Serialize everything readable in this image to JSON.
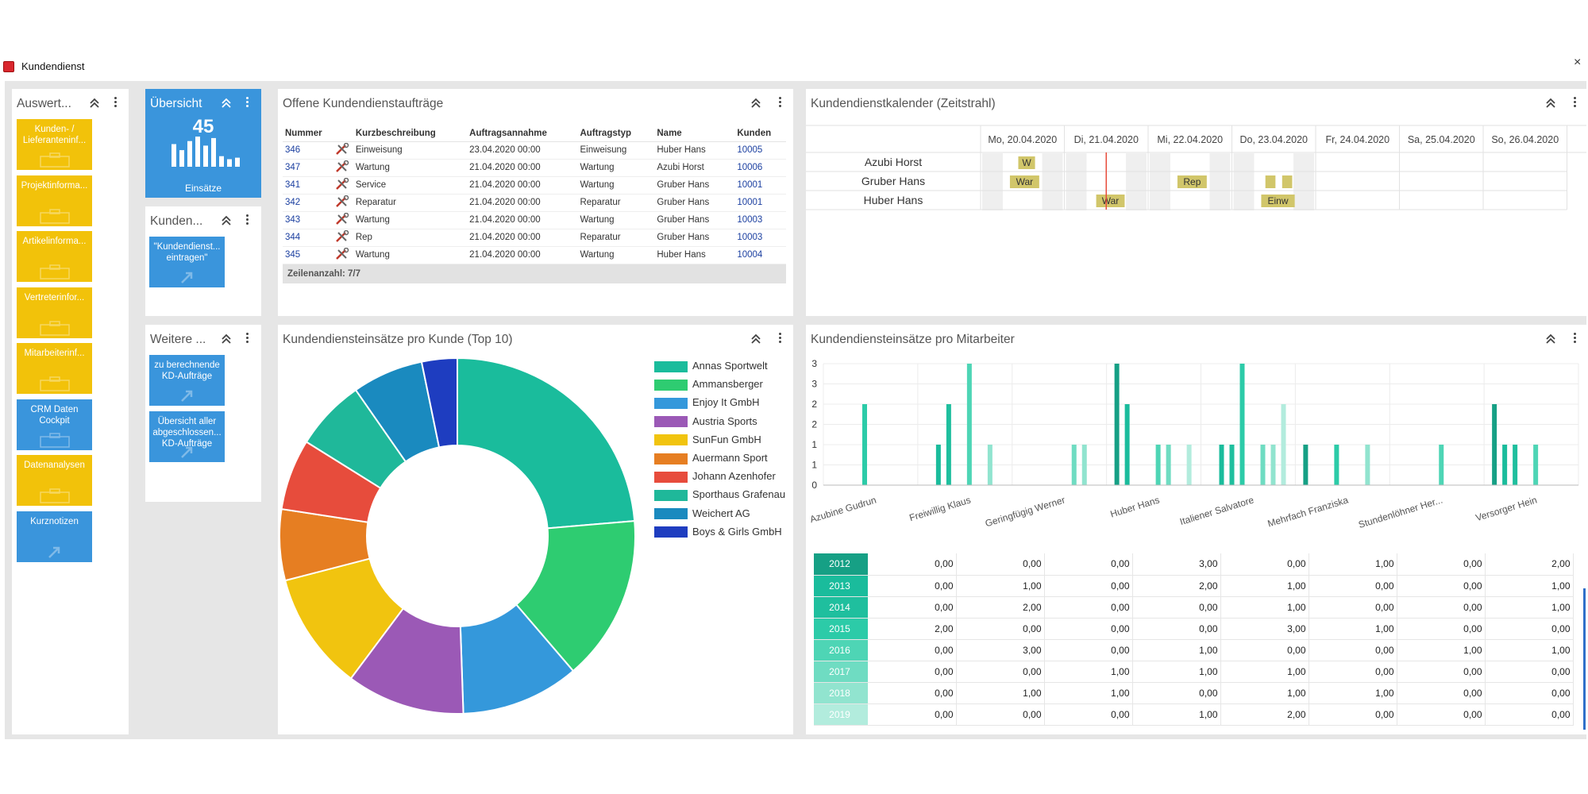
{
  "window": {
    "title": "Kundendienst",
    "close": "×"
  },
  "nav_panel": {
    "title": "Auswert...",
    "tiles": [
      {
        "label": "Kunden- / Lieferanteninf...",
        "color": "yellow"
      },
      {
        "label": "Projektinforma...",
        "color": "yellow"
      },
      {
        "label": "Artikelinforma...",
        "color": "yellow"
      },
      {
        "label": "Vertreterinfor...",
        "color": "yellow"
      },
      {
        "label": "Mitarbeiterinf...",
        "color": "yellow"
      },
      {
        "label": "CRM Daten Cockpit",
        "color": "blue"
      },
      {
        "label": "Datenanalysen",
        "color": "yellow"
      },
      {
        "label": "Kurznotizen",
        "color": "blue"
      }
    ]
  },
  "overview": {
    "title": "Übersicht",
    "value": "45",
    "caption": "Einsätze",
    "sparkline": [
      0.75,
      0.55,
      0.85,
      1.0,
      0.7,
      0.95,
      0.35,
      0.25,
      0.3
    ]
  },
  "kunden_panel": {
    "title": "Kunden...",
    "tiles": [
      {
        "label": "\"Kundendienst... eintragen\""
      }
    ]
  },
  "weitere_panel": {
    "title": "Weitere ...",
    "tiles": [
      {
        "label": "zu berechnende KD-Aufträge"
      },
      {
        "label": "Übersicht aller abgeschlossen... KD-Aufträge"
      }
    ]
  },
  "orders": {
    "title": "Offene Kundendienstaufträge",
    "columns": [
      "Nummer",
      "",
      "Kurzbeschreibung",
      "Auftragsannahme",
      "Auftragstyp",
      "Name",
      "Kunden"
    ],
    "rows": [
      [
        "346",
        "Einweisung",
        "23.04.2020 00:00",
        "Einweisung",
        "Huber Hans",
        "10005"
      ],
      [
        "347",
        "Wartung",
        "21.04.2020 00:00",
        "Wartung",
        "Azubi Horst",
        "10006"
      ],
      [
        "341",
        "Service",
        "21.04.2020 00:00",
        "Wartung",
        "Gruber Hans",
        "10001"
      ],
      [
        "342",
        "Reparatur",
        "21.04.2020 00:00",
        "Reparatur",
        "Gruber Hans",
        "10001"
      ],
      [
        "343",
        "Wartung",
        "21.04.2020 00:00",
        "Wartung",
        "Gruber Hans",
        "10003"
      ],
      [
        "344",
        "Rep",
        "21.04.2020 00:00",
        "Reparatur",
        "Gruber Hans",
        "10003"
      ],
      [
        "345",
        "Wartung",
        "21.04.2020 00:00",
        "Wartung",
        "Huber Hans",
        "10004"
      ]
    ],
    "footer": "Zeilenanzahl: 7/7"
  },
  "calendar": {
    "title": "Kundendienstkalender (Zeitstrahl)",
    "days": [
      "Mo, 20.04.2020",
      "Di, 21.04.2020",
      "Mi, 22.04.2020",
      "Do, 23.04.2020",
      "Fr, 24.04.2020",
      "Sa, 25.04.2020",
      "So, 26.04.2020"
    ],
    "resources": [
      {
        "name": "Azubi Horst",
        "events": [
          {
            "label": "W",
            "day": 0,
            "start": 0.45,
            "end": 0.65
          }
        ]
      },
      {
        "name": "Gruber Hans",
        "events": [
          {
            "label": "War",
            "day": 0,
            "start": 0.35,
            "end": 0.7
          },
          {
            "label": "Rep",
            "day": 2,
            "start": 0.35,
            "end": 0.7
          },
          {
            "label": "",
            "day": 3,
            "start": 0.4,
            "end": 0.52
          },
          {
            "label": "",
            "day": 3,
            "start": 0.6,
            "end": 0.72
          }
        ]
      },
      {
        "name": "Huber Hans",
        "events": [
          {
            "label": "War",
            "day": 1,
            "start": 0.38,
            "end": 0.72
          },
          {
            "label": "Einw",
            "day": 3,
            "start": 0.35,
            "end": 0.75
          }
        ]
      }
    ],
    "now_day": 1,
    "now_frac": 0.5
  },
  "pie": {
    "title": "Kundendiensteinsätze pro Kunde (Top 10)",
    "chart_data": {
      "type": "pie",
      "labels": [
        "Annas Sportwelt",
        "Ammansberger",
        "Enjoy It GmbH",
        "Austria Sports",
        "SunFun GmbH",
        "Auermann Sport",
        "Johann Azenhofer",
        "Sporthaus Grafenau",
        "Weichert AG",
        "Boys & Girls GmbH"
      ],
      "values": [
        11,
        7,
        5,
        5,
        5,
        3,
        3,
        3,
        3,
        1.5
      ],
      "colors": [
        "#1abc9c",
        "#2ecc71",
        "#3498db",
        "#9b59b6",
        "#f1c40f",
        "#e67e22",
        "#e74c3c",
        "#1fb89a",
        "#1a8abf",
        "#1e3dc0"
      ]
    }
  },
  "bar": {
    "title": "Kundendiensteinsätze pro Mitarbeiter",
    "chart_data": {
      "type": "bar",
      "categories": [
        "Azubine Gudrun",
        "Freiwillig Klaus",
        "Geringfügig Werner",
        "Huber Hans",
        "Italiener Salvatore",
        "Mehrfach Franziska",
        "Stundenlöhner Her...",
        "Versorger Hein"
      ],
      "series": [
        {
          "name": "2012",
          "values": [
            0,
            0,
            0,
            3,
            0,
            1,
            0,
            2
          ]
        },
        {
          "name": "2013",
          "values": [
            0,
            1,
            0,
            2,
            1,
            0,
            0,
            1
          ]
        },
        {
          "name": "2014",
          "values": [
            0,
            2,
            0,
            0,
            1,
            0,
            0,
            1
          ]
        },
        {
          "name": "2015",
          "values": [
            2,
            0,
            0,
            0,
            3,
            1,
            0,
            0
          ]
        },
        {
          "name": "2016",
          "values": [
            0,
            3,
            0,
            1,
            0,
            0,
            1,
            1
          ]
        },
        {
          "name": "2017",
          "values": [
            0,
            0,
            1,
            1,
            1,
            0,
            0,
            0
          ]
        },
        {
          "name": "2018",
          "values": [
            0,
            1,
            1,
            0,
            1,
            1,
            0,
            0
          ]
        },
        {
          "name": "2019",
          "values": [
            0,
            0,
            0,
            1,
            2,
            0,
            0,
            0
          ]
        }
      ],
      "yticks": [
        "3",
        "3",
        "2",
        "2",
        "1",
        "1",
        "0"
      ],
      "ylim": [
        0,
        3
      ],
      "colors": [
        "#16a085",
        "#1abc9c",
        "#1fbf9e",
        "#2ccba8",
        "#4ed5b5",
        "#6fdcc2",
        "#91e4cf",
        "#b2ecdd"
      ]
    },
    "table_rows": [
      {
        "year": "2012",
        "values": [
          "0,00",
          "0,00",
          "0,00",
          "3,00",
          "0,00",
          "1,00",
          "0,00",
          "2,00"
        ]
      },
      {
        "year": "2013",
        "values": [
          "0,00",
          "1,00",
          "0,00",
          "2,00",
          "1,00",
          "0,00",
          "0,00",
          "1,00"
        ]
      },
      {
        "year": "2014",
        "values": [
          "0,00",
          "2,00",
          "0,00",
          "0,00",
          "1,00",
          "0,00",
          "0,00",
          "1,00"
        ]
      },
      {
        "year": "2015",
        "values": [
          "2,00",
          "0,00",
          "0,00",
          "0,00",
          "3,00",
          "1,00",
          "0,00",
          "0,00"
        ]
      },
      {
        "year": "2016",
        "values": [
          "0,00",
          "3,00",
          "0,00",
          "1,00",
          "0,00",
          "0,00",
          "1,00",
          "1,00"
        ]
      },
      {
        "year": "2017",
        "values": [
          "0,00",
          "0,00",
          "1,00",
          "1,00",
          "1,00",
          "0,00",
          "0,00",
          "0,00"
        ]
      },
      {
        "year": "2018",
        "values": [
          "0,00",
          "1,00",
          "1,00",
          "0,00",
          "1,00",
          "1,00",
          "0,00",
          "0,00"
        ]
      },
      {
        "year": "2019",
        "values": [
          "0,00",
          "0,00",
          "0,00",
          "1,00",
          "2,00",
          "0,00",
          "0,00",
          "0,00"
        ]
      }
    ]
  }
}
